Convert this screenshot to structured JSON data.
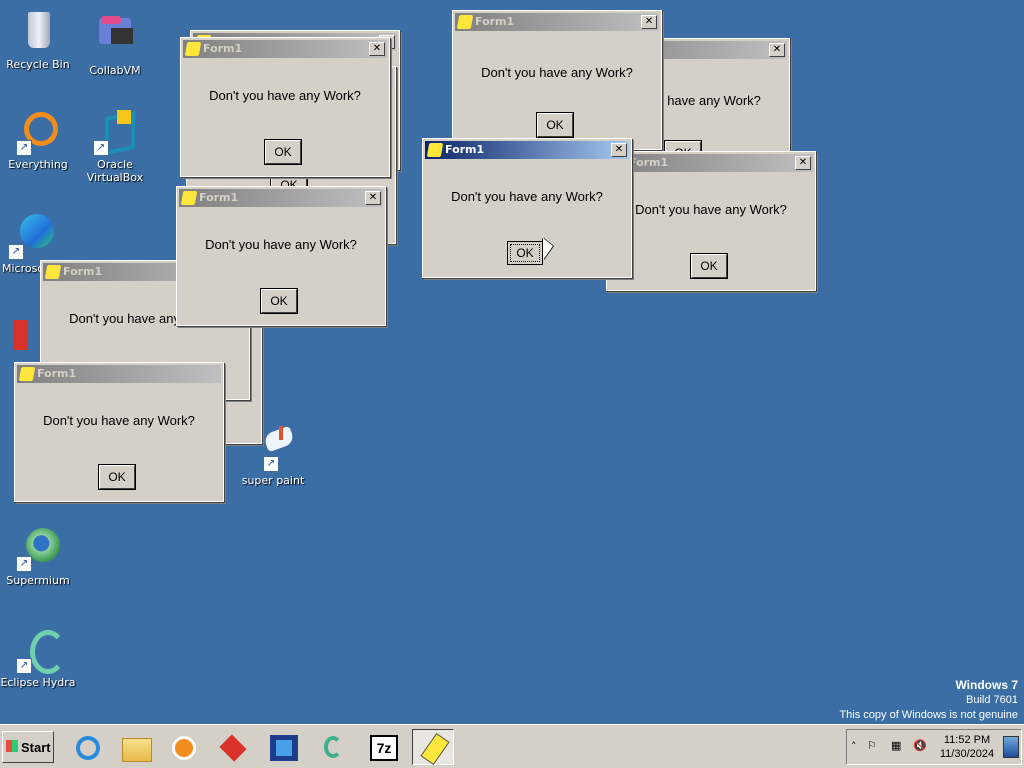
{
  "desktop_icons": [
    {
      "label": "Recycle Bin",
      "icon": "recycle-bin-icon"
    },
    {
      "label": "CollabVM",
      "icon": "collabvm-icon"
    },
    {
      "label": "Everything",
      "icon": "everything-icon"
    },
    {
      "label": "Oracle VirtualBox",
      "icon": "virtualbox-icon"
    },
    {
      "label": "Microsoft",
      "icon": "edge-icon"
    },
    {
      "label": "super paint",
      "icon": "super-paint-icon"
    },
    {
      "label": "Supermium",
      "icon": "supermium-icon"
    },
    {
      "label": "Eclipse Hydra",
      "icon": "eclipse-hydra-icon"
    }
  ],
  "dialog": {
    "title": "Form1",
    "message": "Don't you have any Work?",
    "ok_label": "OK",
    "close_glyph": "✕"
  },
  "watermark": {
    "line1": "Windows 7",
    "line2": "Build 7601",
    "line3": "This copy of Windows is not genuine"
  },
  "taskbar": {
    "start_label": "Start",
    "buttons": [
      "internet-explorer-icon",
      "file-explorer-icon",
      "media-player-icon",
      "collabvm-app-icon",
      "virtualbox-app-icon",
      "eclipse-hydra-app-icon",
      "7zip-icon",
      "form1-app-icon"
    ],
    "zip_label": "7z",
    "tray": {
      "time": "11:52 PM",
      "date": "11/30/2024",
      "show_hidden": "˄",
      "flag": "⚐",
      "network": "▦",
      "volume": "🔇"
    }
  },
  "colors": {
    "desktop": "#3b6ea5",
    "active_title": "#0a246a",
    "inactive_title": "#808080"
  }
}
